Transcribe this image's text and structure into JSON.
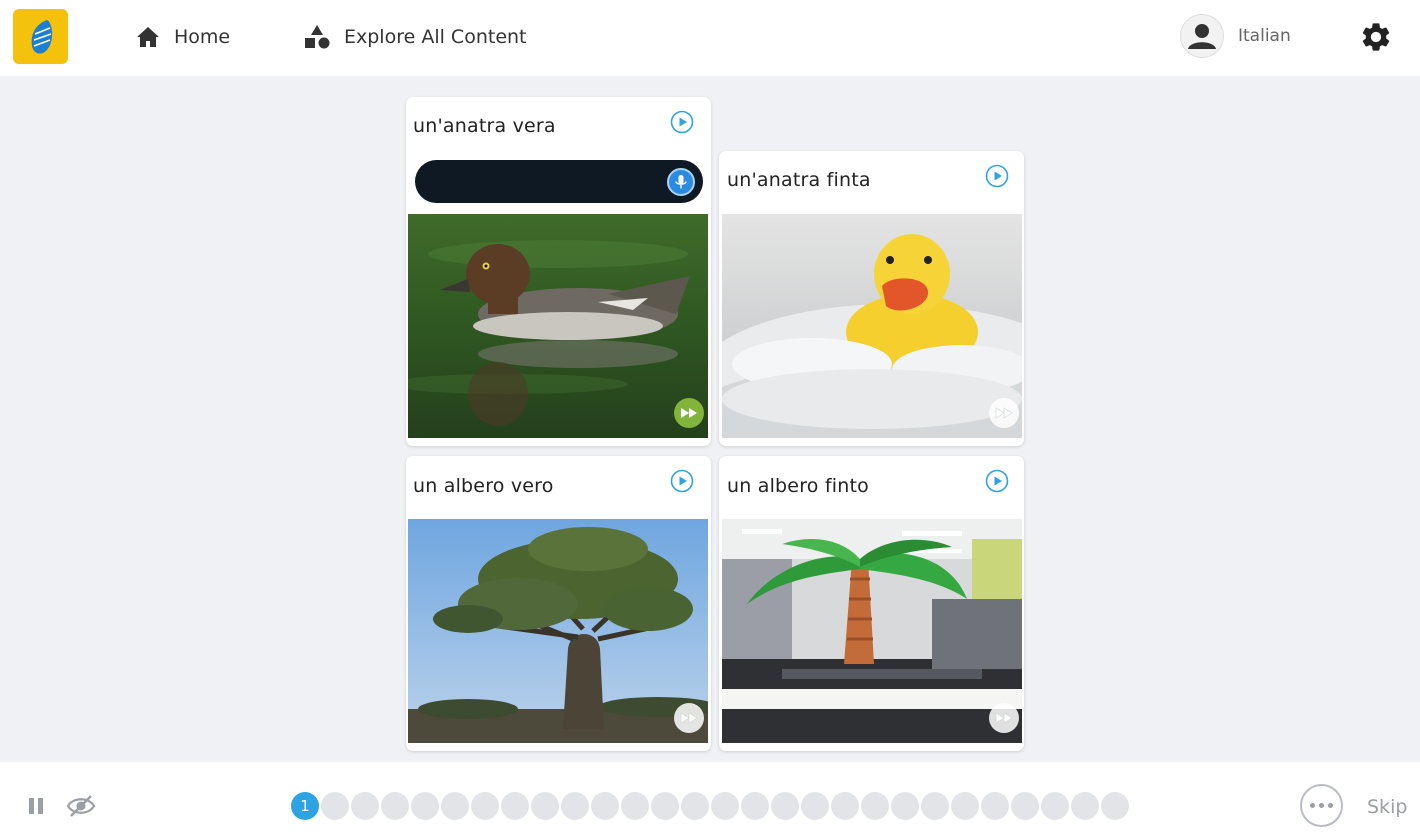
{
  "header": {
    "nav": [
      {
        "label": "Home",
        "icon": "home-icon"
      },
      {
        "label": "Explore All Content",
        "icon": "shapes-icon"
      }
    ],
    "profile": {
      "language": "Italian"
    },
    "colors": {
      "logo": "#f4c20d"
    }
  },
  "cards": [
    {
      "title": "un'anatra vera",
      "image": "duck photo",
      "ff_state": "active"
    },
    {
      "title": "un'anatra finta",
      "image": "rubber duck photo",
      "ff_state": "inactive"
    },
    {
      "title": "un albero vero",
      "image": "baobab tree photo",
      "ff_state": "inactive"
    },
    {
      "title": "un albero finto",
      "image": "inflatable palm tree in office photo",
      "ff_state": "inactive"
    }
  ],
  "speech_input": {
    "accent_color": "#2b8be0"
  },
  "footer": {
    "progress": {
      "current": "1",
      "total": 28
    },
    "skip_label": "Skip",
    "colors": {
      "active_dot": "#2ea3e3",
      "inactive_dot": "#e2e4e8"
    }
  }
}
